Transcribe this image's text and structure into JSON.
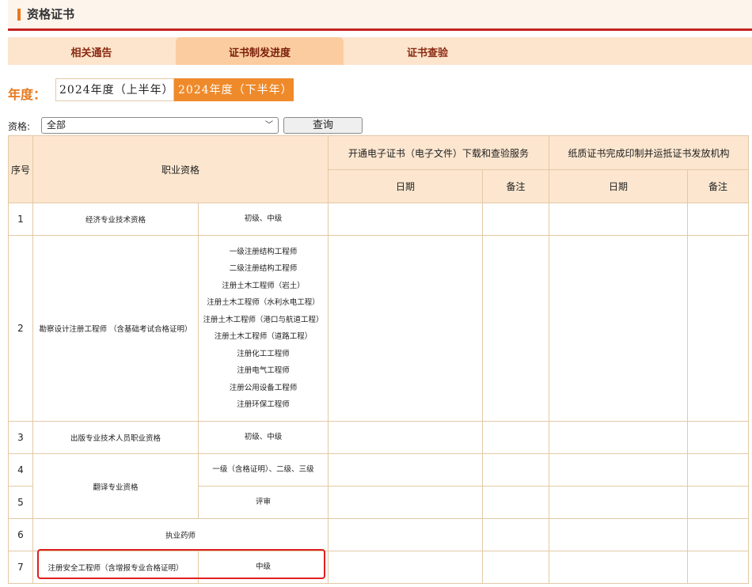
{
  "header": {
    "title": "资格证书"
  },
  "tabs": [
    {
      "label": "相关通告",
      "active": false
    },
    {
      "label": "证书制发进度",
      "active": true
    },
    {
      "label": "证书查验",
      "active": false
    }
  ],
  "year": {
    "label": "年度：",
    "options": [
      {
        "label": "2024年度（上半年）",
        "active": false
      },
      {
        "label": "2024年度（下半年）",
        "active": true
      }
    ]
  },
  "filter": {
    "label": "资格:",
    "selected": "全部",
    "query_button": "查询"
  },
  "table": {
    "headers": {
      "seq": "序号",
      "qualification": "职业资格",
      "group1": "开通电子证书（电子文件）下载和查验服务",
      "group2": "纸质证书完成印制并运抵证书发放机构",
      "date": "日期",
      "note": "备注"
    },
    "rows": [
      {
        "seq": "1",
        "name": "经济专业技术资格",
        "levels": [
          "初级、中级"
        ]
      },
      {
        "seq": "2",
        "name": "勘察设计注册工程师 （含基础考试合格证明）",
        "levels": [
          "一级注册结构工程师",
          "二级注册结构工程师",
          "注册土木工程师（岩土）",
          "注册土木工程师（水利水电工程）",
          "注册土木工程师（港口与航道工程）",
          "注册土木工程师（道路工程）",
          "注册化工工程师",
          "注册电气工程师",
          "注册公用设备工程师",
          "注册环保工程师"
        ]
      },
      {
        "seq": "3",
        "name": "出版专业技术人员职业资格",
        "levels": [
          "初级、中级"
        ]
      },
      {
        "seq": "4",
        "name": "翻译专业资格",
        "levels": [
          "一级（含格证明）、二级、三级"
        ]
      },
      {
        "seq": "5",
        "name": "",
        "levels": [
          "评审"
        ]
      },
      {
        "seq": "6",
        "name": "执业药师",
        "levels": []
      },
      {
        "seq": "7",
        "name": "注册安全工程师（含增报专业合格证明）",
        "levels": [
          "中级"
        ]
      }
    ]
  },
  "colors": {
    "accent": "#ef8a2b",
    "header_rule": "#c62222",
    "tab_bg": "#fde4cc",
    "highlight": "#e02020"
  }
}
